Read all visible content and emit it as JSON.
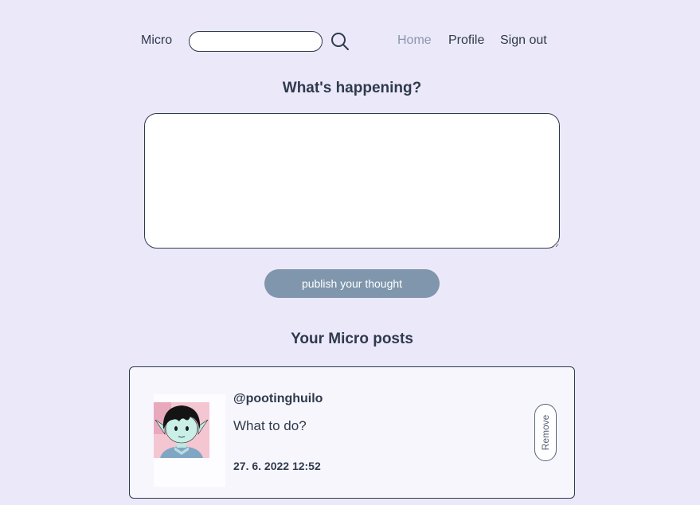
{
  "header": {
    "brand": "Micro",
    "search": {
      "value": "",
      "placeholder": ""
    },
    "nav": {
      "home": "Home",
      "profile": "Profile",
      "sign_out": "Sign out"
    }
  },
  "compose": {
    "title": "What's happening?",
    "value": "",
    "placeholder": "",
    "publish_label": "publish your thought"
  },
  "posts_section": {
    "title": "Your Micro posts",
    "posts": [
      {
        "handle": "@pootinghuilo",
        "text": "What to do?",
        "timestamp": "27. 6. 2022 12:52",
        "remove_label": "Remove",
        "avatar_icon": "cartoon-girl-avatar"
      }
    ]
  },
  "colors": {
    "background": "#ebe8f9",
    "text": "#2f3a4d",
    "active_nav": "#8b97ab",
    "button": "#7f96ac"
  },
  "icons": {
    "search": "search-icon"
  }
}
